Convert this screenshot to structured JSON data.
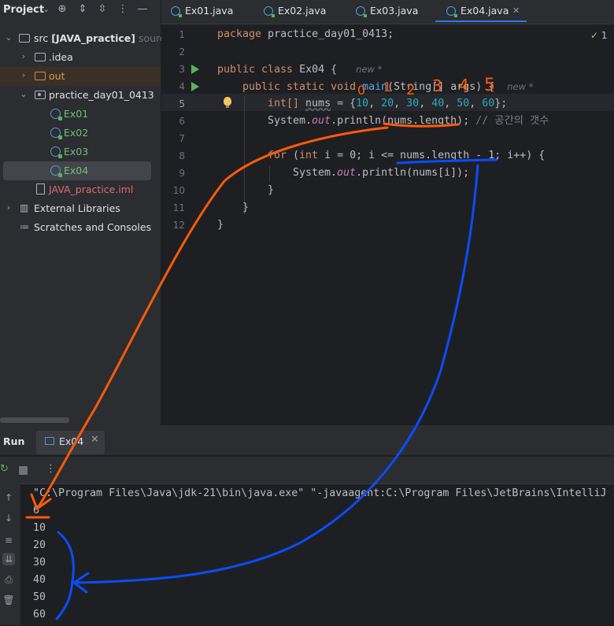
{
  "project_panel": {
    "title": "Project",
    "tree": [
      {
        "label": "src",
        "bold_suffix": "[JAVA_practice]",
        "suffix": "source",
        "type": "folder",
        "expanded": true
      },
      {
        "label": ".idea",
        "type": "folder",
        "expanded": false
      },
      {
        "label": "out",
        "type": "folder-out",
        "expanded": false
      },
      {
        "label": "practice_day01_0413",
        "type": "package",
        "expanded": true
      },
      {
        "label": "Ex01",
        "type": "class"
      },
      {
        "label": "Ex02",
        "type": "class"
      },
      {
        "label": "Ex03",
        "type": "class"
      },
      {
        "label": "Ex04",
        "type": "class",
        "selected": true
      },
      {
        "label": "JAVA_practice.iml",
        "type": "iml"
      },
      {
        "label": "External Libraries",
        "type": "libraries",
        "expanded": false
      },
      {
        "label": "Scratches and Consoles",
        "type": "scratches"
      }
    ]
  },
  "tabs": [
    {
      "label": "Ex01.java"
    },
    {
      "label": "Ex02.java"
    },
    {
      "label": "Ex03.java"
    },
    {
      "label": "Ex04.java",
      "active": true,
      "close": "✕"
    }
  ],
  "editor": {
    "inspection_count": "1",
    "line_numbers": [
      "1",
      "2",
      "3",
      "4",
      "5",
      "6",
      "7",
      "8",
      "9",
      "10",
      "11",
      "12"
    ],
    "current_line": "5",
    "hints": {
      "class_hint": "new *",
      "method_hint": "new *"
    },
    "code": {
      "l1_kw": "package",
      "l1_rest": " practice_day01_0413;",
      "l3_kw": "public class",
      "l3_rest": " Ex04 {",
      "l4_kw": "public static void",
      "l4_fn": "main",
      "l4_rest": "(String[] args) {",
      "l5_type": "int[]",
      "l5_var": "nums",
      "l5_eq": " = {",
      "l5_values": [
        "10",
        "20",
        "30",
        "40",
        "50",
        "60"
      ],
      "l5_end": "};",
      "l6_obj": "System.",
      "l6_out": "out",
      "l6_call": ".println(nums.length);",
      "l6_comment": "// 공간의 갯수",
      "l8_kw": "for",
      "l8_open": " (",
      "l8_int": "int",
      "l8_rest": " i = 0; i <= nums.length - 1; i++) {",
      "l9_obj": "System.",
      "l9_out": "out",
      "l9_rest": ".println(nums[i]);",
      "l10": "}",
      "l11": "}",
      "l12": "}"
    }
  },
  "run_panel": {
    "title": "Run",
    "tab_label": "Ex04",
    "tab_close": "✕",
    "command": "\"C:\\Program Files\\Java\\jdk-21\\bin\\java.exe\" \"-javaagent:C:\\Program Files\\JetBrains\\IntelliJ I",
    "output": [
      "6",
      "10",
      "20",
      "30",
      "40",
      "50",
      "60"
    ]
  },
  "annotations": {
    "orange_color": "#ff5a0a",
    "blue_color": "#0a4cff",
    "index_marks": [
      "0",
      "1",
      "2",
      "3",
      "4",
      "5"
    ]
  }
}
